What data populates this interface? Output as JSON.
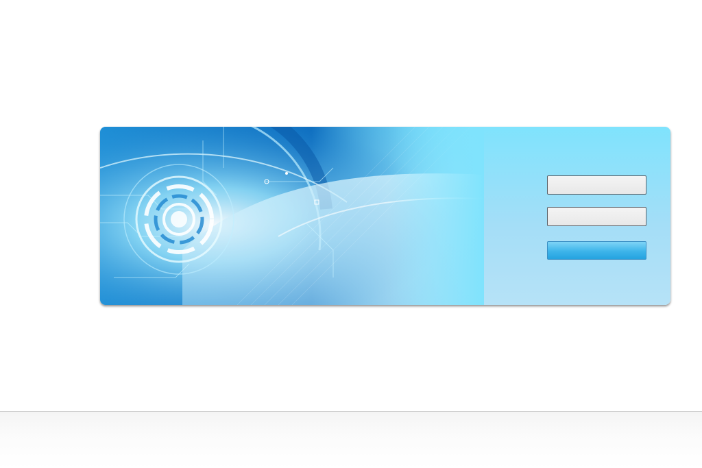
{
  "login": {
    "username_placeholder": "",
    "password_placeholder": "",
    "submit_label": ""
  },
  "colors": {
    "panel_top": "#7fe3fd",
    "panel_bottom": "#b6e2f7",
    "button_accent": "#25a3e0",
    "field_border": "#5b6168"
  },
  "icons": {
    "banner": "tech-circuit-banner-graphic"
  }
}
